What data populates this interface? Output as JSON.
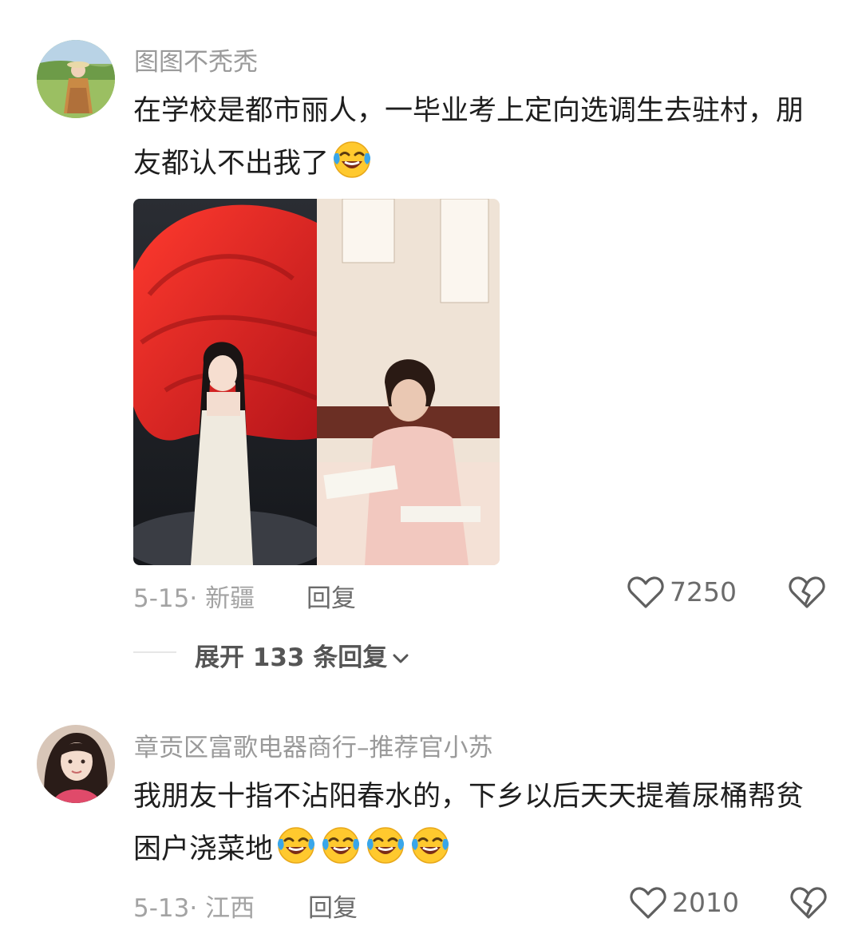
{
  "comments": [
    {
      "username": "图图不秃秃",
      "text": "在学校是都市丽人，一毕业考上定向选调生去驻村，朋友都认不出我了",
      "emoji_count": 1,
      "emoji": "laughing-crying-emoji",
      "date_location": "5-15· 新疆",
      "reply_label": "回复",
      "likes": "7250",
      "expand_label": "展开 133 条回复"
    },
    {
      "username": "章贡区富歌电器商行–推荐官小苏",
      "text": "我朋友十指不沾阳春水的，下乡以后天天提着尿桶帮贫困户浇菜地",
      "emoji_count": 4,
      "emoji": "laughing-crying-emoji",
      "date_location": "5-13· 江西",
      "reply_label": "回复",
      "likes": "2010"
    }
  ],
  "icons": {
    "like": "heart-outline-icon",
    "dislike": "broken-heart-icon",
    "expand": "chevron-down-icon"
  },
  "colors": {
    "text": "#1e1e1e",
    "secondary": "#9a9a9a",
    "red_cloth": "#d92323",
    "emoji_yellow": "#ffc92e",
    "tears_blue": "#39a6ea"
  }
}
